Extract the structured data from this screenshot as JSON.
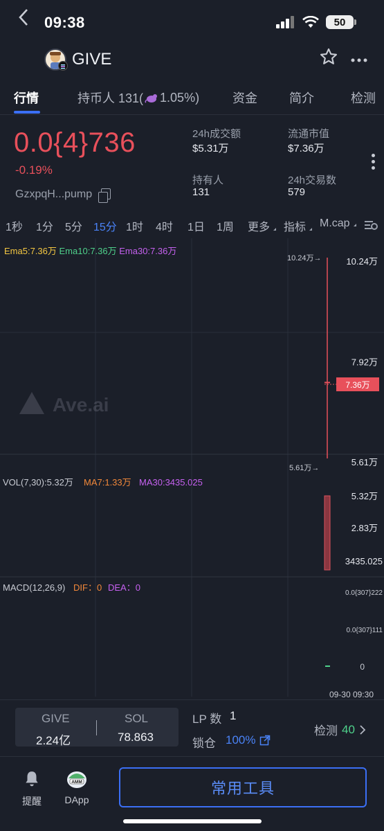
{
  "status_bar": {
    "time": "09:38",
    "battery": "50"
  },
  "header": {
    "token_name": "GIVE"
  },
  "tabs": [
    {
      "label": "行情"
    },
    {
      "label": "持币人 131("
    },
    {
      "label": "1.05%)"
    },
    {
      "label": "资金"
    },
    {
      "label": "简介"
    },
    {
      "label": "检测"
    }
  ],
  "price": {
    "value": "0.0{4}736",
    "change": "-0.19%",
    "address": "GzxpqH...pump"
  },
  "stats": [
    {
      "label": "24h成交额",
      "value": "$5.31万"
    },
    {
      "label": "流通市值",
      "value": "$7.36万"
    },
    {
      "label": "持有人",
      "value": "131"
    },
    {
      "label": "24h交易数",
      "value": "579"
    }
  ],
  "intervals": [
    "1秒",
    "1分",
    "5分",
    "15分",
    "1时",
    "4时",
    "1日",
    "1周",
    "更多",
    "指标",
    "M.cap"
  ],
  "active_interval": "15分",
  "chart": {
    "ema": {
      "ema5": "Ema5:7.36万",
      "ema10": "Ema10:7.36万",
      "ema30": "Ema30:7.36万"
    },
    "price_axis": [
      "10.24万",
      "7.92万",
      "5.61万"
    ],
    "current_price_tag": "7.36万",
    "high_marker": "10.24万→",
    "low_marker": "5.61万→",
    "watermark": "Ave.ai",
    "candle": {
      "high": 10.24,
      "low": 5.61,
      "open": 10.24,
      "close": 7.36
    },
    "vol_legend": {
      "vol": "VOL(7,30):5.32万",
      "ma7": "MA7:1.33万",
      "ma30": "MA30:3435.025"
    },
    "vol_axis": [
      "5.32万",
      "2.83万",
      "3435.025"
    ],
    "macd_legend": {
      "name": "MACD(12,26,9)",
      "dif": "DIF：0",
      "dea": "DEA：0"
    },
    "macd_axis": [
      "0.0{307}222",
      "0.0{307}111",
      "0"
    ],
    "time_label": "09-30 09:30",
    "colors": {
      "up": "#e8505b",
      "ema5": "#f5c842",
      "ema10": "#4fd18b",
      "ema30": "#c661f0",
      "vol": "#c661f0",
      "ma7": "#f2883a"
    }
  },
  "swap": {
    "token_a": "GIVE",
    "token_b": "SOL",
    "amount_a": "2.24亿",
    "amount_b": "78.863"
  },
  "lp": {
    "label": "LP 数",
    "count": "1",
    "lock_label": "锁仓",
    "lock_value": "100%"
  },
  "check": {
    "label": "检测",
    "value": "40"
  },
  "bottom_nav": {
    "alert": "提醒",
    "dapp": "DApp",
    "tools": "常用工具"
  }
}
